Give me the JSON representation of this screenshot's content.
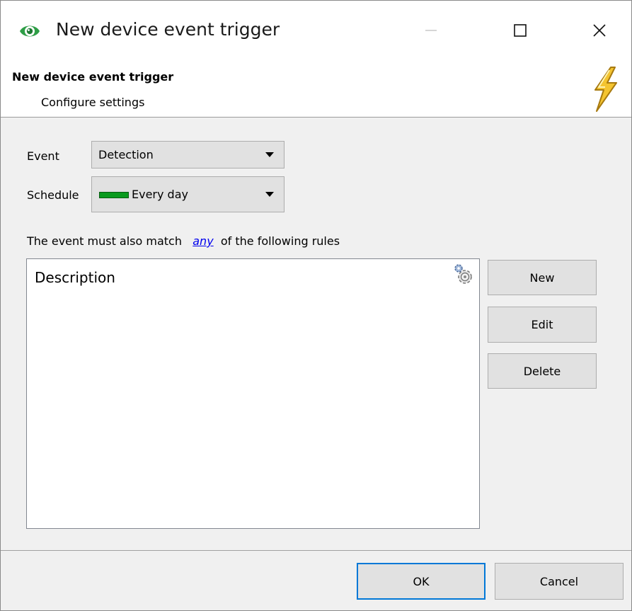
{
  "window": {
    "title": "New device event trigger",
    "icons": {
      "app": "eye-icon",
      "minimize": "minimize-icon",
      "maximize": "maximize-icon",
      "close": "close-icon"
    }
  },
  "header": {
    "title": "New device event trigger",
    "subtitle": "Configure settings",
    "icon": "lightning-bolt-icon"
  },
  "form": {
    "event_label": "Event",
    "event_value": "Detection",
    "schedule_label": "Schedule",
    "schedule_value": "Every day",
    "schedule_color": "#0a9a1e"
  },
  "rules": {
    "prefix": "The event must also match",
    "link": "any",
    "suffix": "of the following rules",
    "column_header": "Description",
    "rows": [],
    "settings_icon": "gear-icon"
  },
  "actions": {
    "new": "New",
    "edit": "Edit",
    "delete": "Delete"
  },
  "footer": {
    "ok": "OK",
    "cancel": "Cancel",
    "accent_color": "#0078d7"
  }
}
